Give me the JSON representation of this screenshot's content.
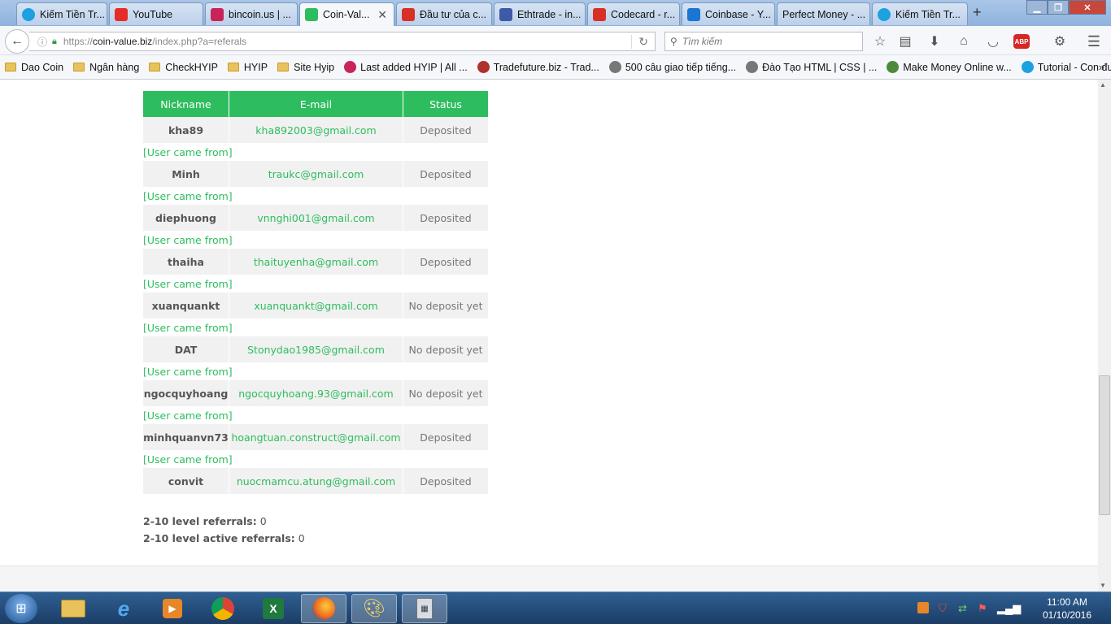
{
  "browser": {
    "tabs": [
      {
        "label": "Kiếm Tiền Tr...",
        "icon": "skype-icon",
        "color": "#1da1e0"
      },
      {
        "label": "YouTube",
        "icon": "youtube-icon",
        "color": "#e52d27"
      },
      {
        "label": "bincoin.us | ...",
        "icon": "a-icon",
        "color": "#c8245a"
      },
      {
        "label": "Coin-Val...",
        "icon": "coin-value-icon",
        "color": "#2ebd5e",
        "active": true
      },
      {
        "label": "Đầu tư của c...",
        "icon": "gmail-icon",
        "color": "#d93025"
      },
      {
        "label": "Ethtrade - in...",
        "icon": "ethereum-icon",
        "color": "#3c5aa6"
      },
      {
        "label": "Codecard - r...",
        "icon": "gmail-icon",
        "color": "#d93025"
      },
      {
        "label": "Coinbase - Y...",
        "icon": "coinbase-icon",
        "color": "#1a76d2"
      },
      {
        "label": "Perfect Money - ...",
        "icon": "none",
        "color": ""
      },
      {
        "label": "Kiếm Tiền Tr...",
        "icon": "skype-icon",
        "color": "#1da1e0"
      }
    ],
    "new_tab": "+",
    "url_prefix": "https://",
    "url_domain": "coin-value.biz",
    "url_path": "/index.php?a=referals",
    "search_placeholder": "Tìm kiếm"
  },
  "bookmarks": [
    {
      "label": "Dao Coin",
      "type": "folder"
    },
    {
      "label": "Ngân hàng",
      "type": "folder"
    },
    {
      "label": "CheckHYIP",
      "type": "folder"
    },
    {
      "label": "HYIP",
      "type": "folder"
    },
    {
      "label": "Site Hyip",
      "type": "folder"
    },
    {
      "label": "Last added HYIP | All ...",
      "type": "site",
      "color": "#c8245a"
    },
    {
      "label": "Tradefuture.biz - Trad...",
      "type": "site",
      "color": "#b0302c"
    },
    {
      "label": "500 câu giao tiếp tiếng...",
      "type": "site",
      "color": "#777"
    },
    {
      "label": "Đào Tạo HTML | CSS | ...",
      "type": "site",
      "color": "#777"
    },
    {
      "label": "Make Money Online w...",
      "type": "site",
      "color": "#4a8a3a"
    },
    {
      "label": "Tutorial - Con đường ...",
      "type": "site",
      "color": "#1da1e0"
    }
  ],
  "bookmarks_overflow": "»",
  "referrals": {
    "headers": {
      "nickname": "Nickname",
      "email": "E-mail",
      "status": "Status"
    },
    "came_from_label": "[User came from]",
    "rows": [
      {
        "nickname": "kha89",
        "email": "kha892003@gmail.com",
        "status": "Deposited"
      },
      {
        "nickname": "Minh",
        "email": "traukc@gmail.com",
        "status": "Deposited"
      },
      {
        "nickname": "diephuong",
        "email": "vnnghi001@gmail.com",
        "status": "Deposited"
      },
      {
        "nickname": "thaiha",
        "email": "thaituyenha@gmail.com",
        "status": "Deposited"
      },
      {
        "nickname": "xuanquankt",
        "email": "xuanquankt@gmail.com",
        "status": "No deposit yet"
      },
      {
        "nickname": "DAT",
        "email": "Stonydao1985@gmail.com",
        "status": "No deposit yet"
      },
      {
        "nickname": "ngocquyhoang",
        "email": "ngocquyhoang.93@gmail.com",
        "status": "No deposit yet"
      },
      {
        "nickname": "minhquanvn73",
        "email": "hoangtuan.construct@gmail.com",
        "status": "Deposited"
      },
      {
        "nickname": "convit",
        "email": "nuocmamcu.atung@gmail.com",
        "status": "Deposited"
      }
    ],
    "level_referrals_label": "2-10 level referrals:",
    "level_referrals_value": "0",
    "level_active_label": "2-10 level active referrals:",
    "level_active_value": "0"
  },
  "taskbar": {
    "clock_time": "11:00 AM",
    "clock_date": "01/10/2016"
  },
  "colors": {
    "accent": "#2ebd5e",
    "status_text": "#777777"
  }
}
